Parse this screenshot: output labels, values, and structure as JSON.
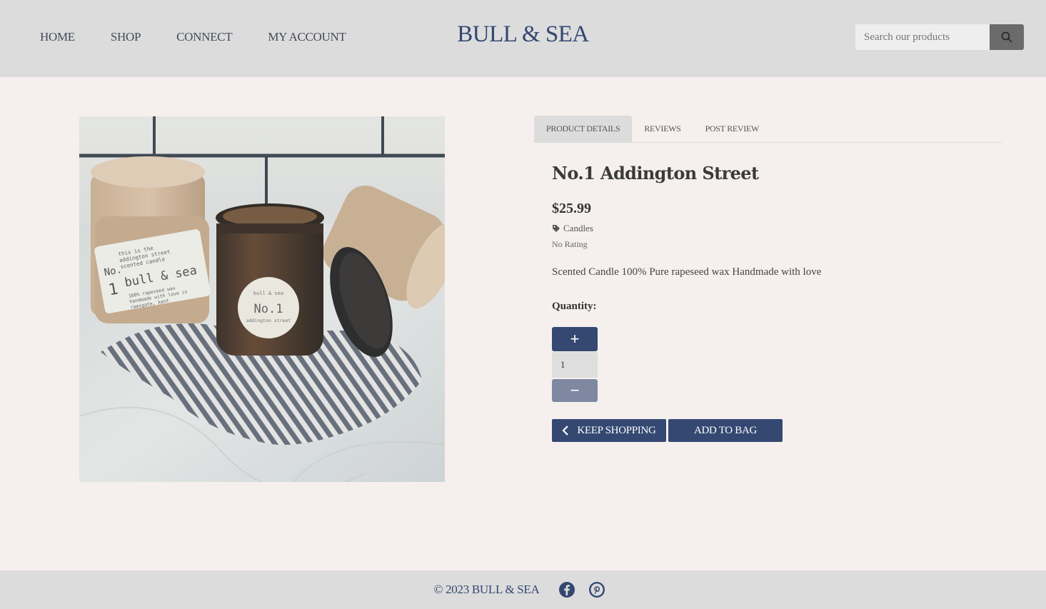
{
  "nav": {
    "items": [
      {
        "label": "HOME"
      },
      {
        "label": "SHOP"
      },
      {
        "label": "CONNECT"
      },
      {
        "label": "MY ACCOUNT"
      }
    ]
  },
  "brand": {
    "name": "BULL & SEA"
  },
  "search": {
    "placeholder": "Search our products",
    "icon": "search-icon"
  },
  "product_image": {
    "jar_label_top": "bull & sea",
    "jar_label_main": "No.1",
    "jar_label_bottom": "addington street",
    "tube_label_lines": [
      "this is the",
      "addington street",
      "scented candle"
    ],
    "tube_label_brand": "bull & sea",
    "tube_label_no": "No.",
    "tube_label_num": "1",
    "tube_label_small": [
      "100% rapeseed wax",
      "handmade with love in",
      "ramsgate, kent"
    ]
  },
  "tabs": [
    {
      "label": "PRODUCT DETAILS",
      "active": true
    },
    {
      "label": "REVIEWS",
      "active": false
    },
    {
      "label": "POST REVIEW",
      "active": false
    }
  ],
  "product": {
    "title": "No.1 Addington Street",
    "price": "$25.99",
    "category": "Candles",
    "category_icon": "tag-icon",
    "rating": "No Rating",
    "description": "Scented Candle 100% Pure rapeseed wax Handmade with love"
  },
  "quantity": {
    "label": "Quantity:",
    "value": "1",
    "plus": "+",
    "minus": "−"
  },
  "buttons": {
    "keep_shopping": "KEEP SHOPPING",
    "add_to_bag": "ADD TO BAG"
  },
  "footer": {
    "copyright": "© 2023 BULL & SEA",
    "social": [
      "facebook-icon",
      "pinterest-icon"
    ]
  },
  "colors": {
    "primary": "#344872",
    "header_bg": "#dcdcdd",
    "page_bg": "#f5f0ed"
  }
}
